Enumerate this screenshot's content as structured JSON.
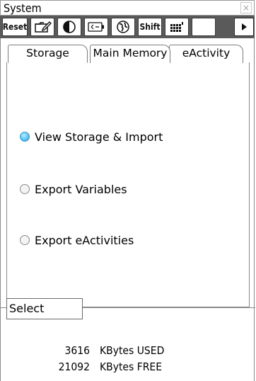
{
  "window": {
    "title": "System",
    "close_glyph": "×"
  },
  "toolbar": {
    "reset_label": "Reset",
    "shift_label": "Shift",
    "icons": [
      "folder-edit-icon",
      "contrast-icon",
      "battery-icon",
      "globe-icon",
      "keyboard-grid-icon",
      "play-icon"
    ]
  },
  "tabs": [
    {
      "label": "Storage",
      "active": true
    },
    {
      "label": "Main Memory",
      "active": false
    },
    {
      "label": "eActivity",
      "active": false
    }
  ],
  "options": [
    {
      "label": "View Storage & Import",
      "selected": true
    },
    {
      "label": "Export Variables",
      "selected": false
    },
    {
      "label": "Export eActivities",
      "selected": false
    }
  ],
  "select_button": "Select",
  "memory": [
    {
      "value": "3616",
      "label": "KBytes USED"
    },
    {
      "value": "21092",
      "label": "KBytes FREE"
    }
  ],
  "colors": {
    "toolbar_bg": "#5a5a5a",
    "radio_selected": "#5cc6f2"
  }
}
